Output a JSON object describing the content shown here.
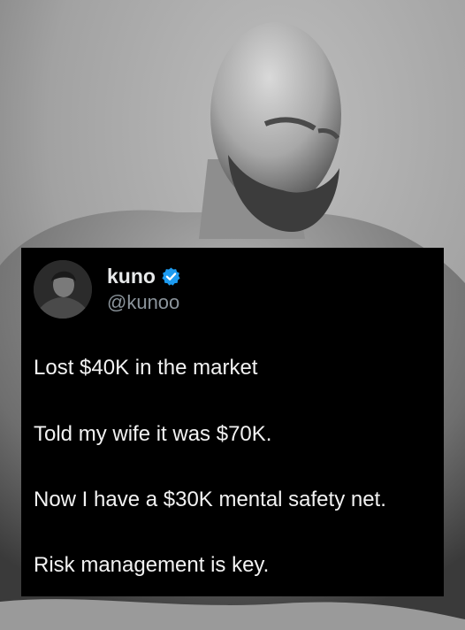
{
  "tweet": {
    "display_name": "kuno",
    "handle": "@kunoo",
    "lines": [
      "Lost $40K in the market",
      "Told my wife it was $70K.",
      "Now I have a $30K mental safety net.",
      "Risk management is key."
    ]
  },
  "colors": {
    "card_background": "#000000",
    "text": "#f2f2f2",
    "handle": "#8b949b",
    "verified_badge": "#1d9bf0"
  },
  "icons": {
    "verified": "verified-badge-icon",
    "avatar": "user-avatar"
  }
}
